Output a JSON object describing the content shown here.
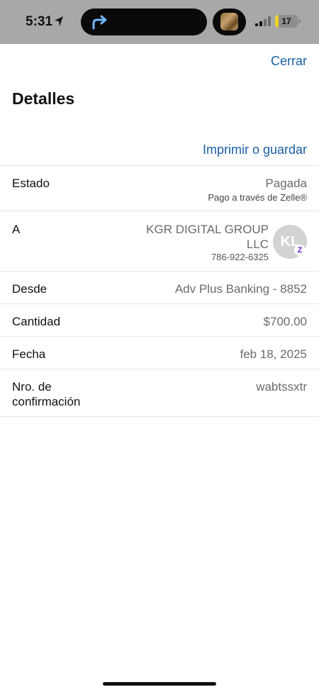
{
  "status_bar": {
    "time": "5:31",
    "battery": "17",
    "battery_level": 0.17,
    "battery_color": "#f2d32a"
  },
  "header": {
    "close_label": "Cerrar",
    "title": "Detalles",
    "print_label": "Imprimir o guardar"
  },
  "details": {
    "status": {
      "label": "Estado",
      "value": "Pagada",
      "sub": "Pago a través de Zelle®"
    },
    "recipient": {
      "label": "A",
      "name": "KGR DIGITAL GROUP LLC",
      "phone": "786-922-6325",
      "initials": "KL",
      "badge": "Z"
    },
    "from": {
      "label": "Desde",
      "value": "Adv Plus Banking - 8852"
    },
    "amount": {
      "label": "Cantidad",
      "value": "$700.00"
    },
    "date": {
      "label": "Fecha",
      "value": "feb 18, 2025"
    },
    "confirmation": {
      "label": "Nro. de confirmación",
      "value": "wabtssxtr"
    }
  },
  "colors": {
    "link": "#1a5fa3",
    "zelle": "#6d1ed4"
  }
}
